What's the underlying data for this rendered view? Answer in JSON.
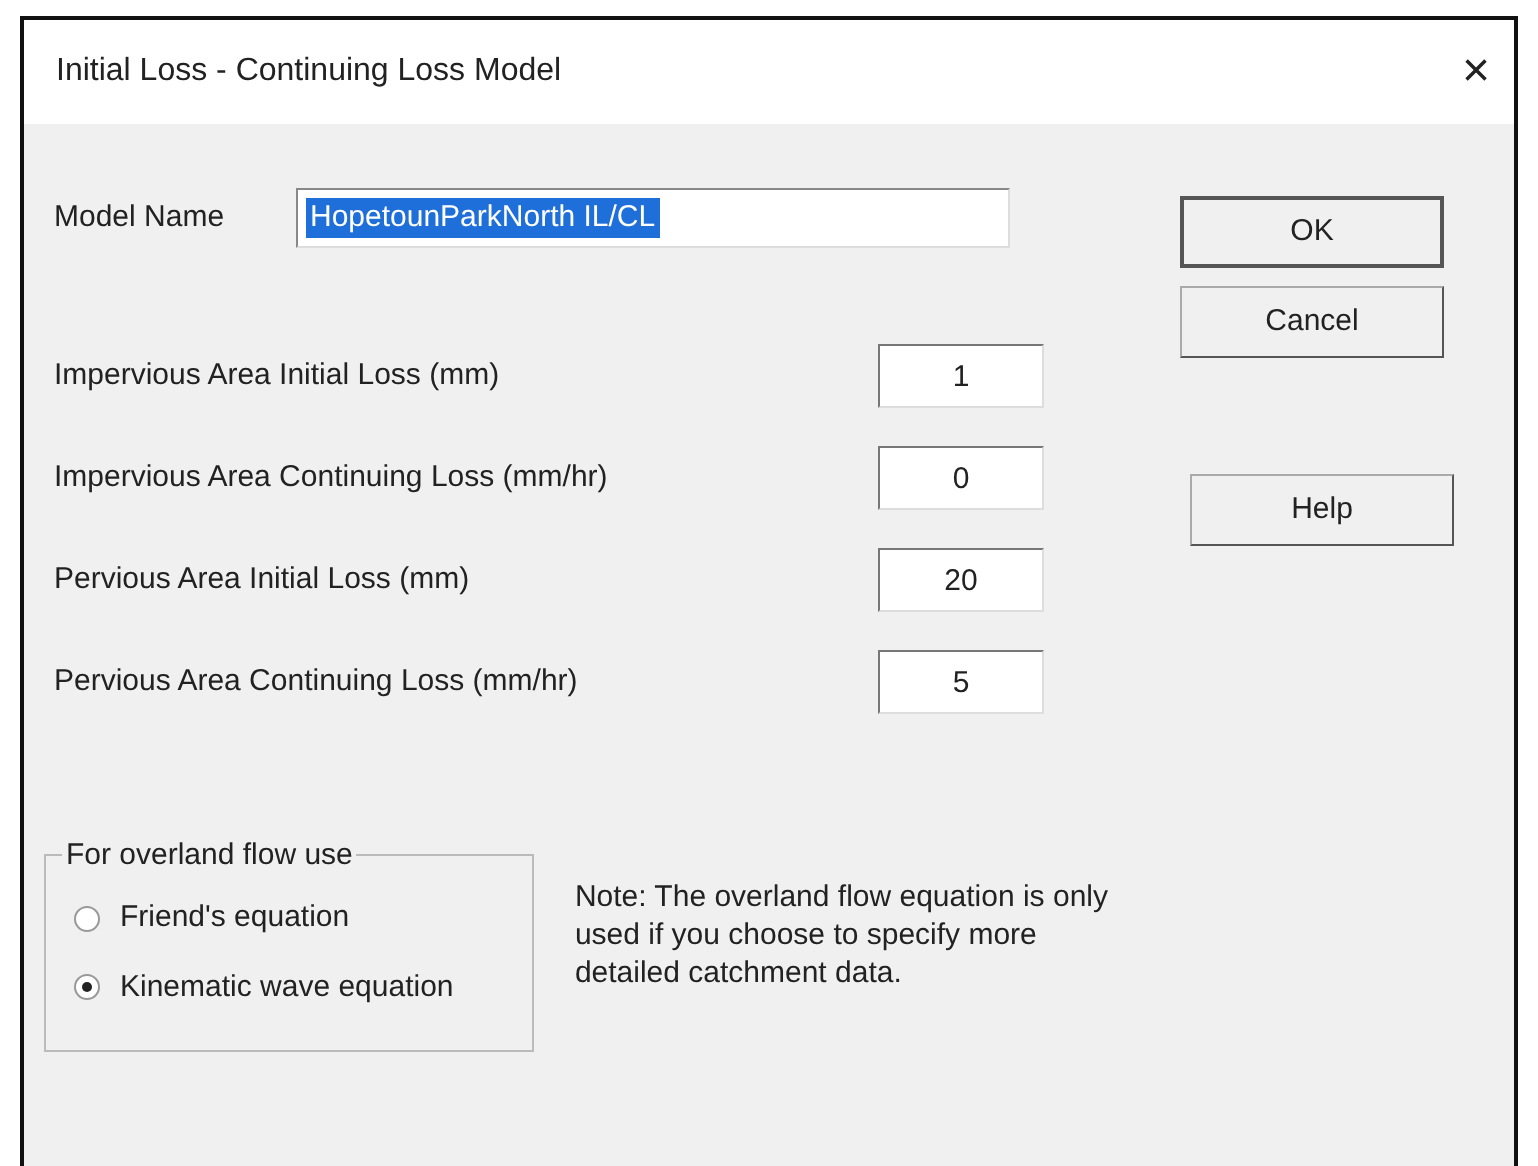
{
  "window": {
    "title": "Initial Loss - Continuing Loss Model",
    "close": "×"
  },
  "model_name": {
    "label": "Model Name",
    "value": "HopetounParkNorth IL/CL",
    "selected": true
  },
  "fields": [
    {
      "label": "Impervious Area Initial Loss (mm)",
      "value": "1"
    },
    {
      "label": "Impervious Area Continuing Loss (mm/hr)",
      "value": "0"
    },
    {
      "label": "Pervious Area Initial Loss (mm)",
      "value": "20"
    },
    {
      "label": "Pervious Area Continuing Loss (mm/hr)",
      "value": "5"
    }
  ],
  "buttons": [
    {
      "label": "OK",
      "kind": "default"
    },
    {
      "label": "Cancel",
      "kind": "normal"
    },
    {
      "label": "Help",
      "kind": "help"
    }
  ],
  "overland_flow": {
    "title": "For overland flow use",
    "options": [
      {
        "label": "Friend's equation",
        "selected": false
      },
      {
        "label": "Kinematic wave equation",
        "selected": true
      }
    ]
  },
  "note": "Note:  The overland flow equation is only used if you choose to specify more detailed catchment data."
}
